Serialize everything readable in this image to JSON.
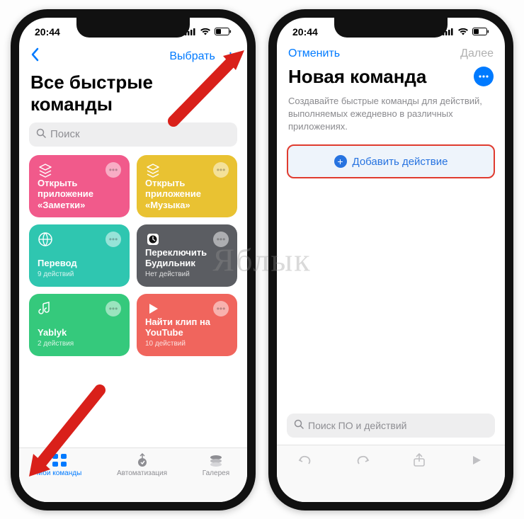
{
  "status": {
    "time": "20:44"
  },
  "left_phone": {
    "navbar": {
      "select_label": "Выбрать"
    },
    "page_title": "Все быстрые команды",
    "search_placeholder": "Поиск",
    "shortcuts": [
      {
        "title": "Открыть приложение «Заметки»",
        "subtitle": "",
        "color": "#f15a8b"
      },
      {
        "title": "Открыть приложение «Музыка»",
        "subtitle": "",
        "color": "#e9c232"
      },
      {
        "title": "Перевод",
        "subtitle": "9 действий",
        "color": "#2fc6b0"
      },
      {
        "title": "Переключить Будильник",
        "subtitle": "Нет действий",
        "color": "#5b5d62"
      },
      {
        "title": "Yablyk",
        "subtitle": "2 действия",
        "color": "#35c97c"
      },
      {
        "title": "Найти клип на YouTube",
        "subtitle": "10 действий",
        "color": "#f0655d"
      }
    ],
    "tabs": {
      "my": "Мои команды",
      "automation": "Автоматизация",
      "gallery": "Галерея"
    }
  },
  "right_phone": {
    "navbar": {
      "cancel": "Отменить",
      "next": "Далее"
    },
    "page_title": "Новая команда",
    "description": "Создавайте быстрые команды для действий, выполняемых ежедневно в различных приложениях.",
    "add_action_label": "Добавить действие",
    "search_placeholder": "Поиск ПО и действий"
  },
  "watermark": "Яблык"
}
